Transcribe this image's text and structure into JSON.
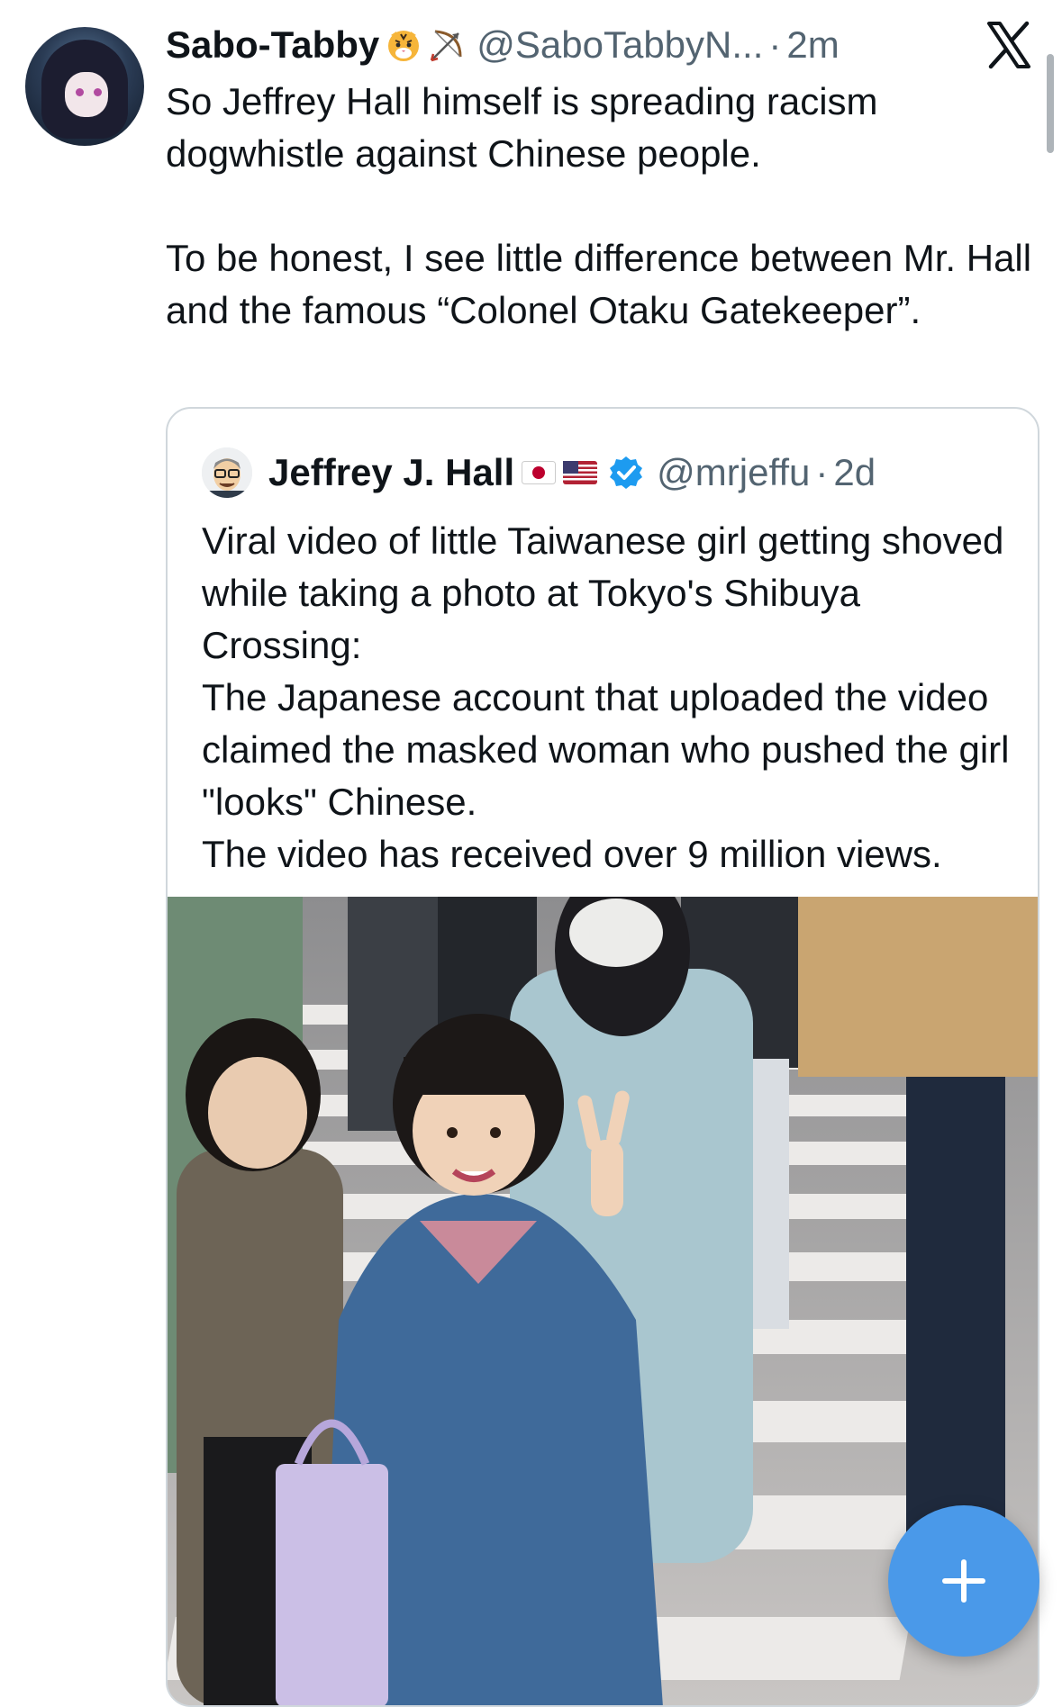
{
  "tweet": {
    "display_name": "Sabo-Tabby",
    "name_emojis": [
      "tiger-face-emoji",
      "bow-and-arrow-emoji"
    ],
    "handle": "@SaboTabbyN...",
    "separator": "·",
    "time": "2m",
    "paragraphs": [
      "So Jeffrey Hall himself is spreading racism dogwhistle against Chinese people.",
      "To be honest, I see little difference between Mr. Hall and the famous “Colonel Otaku Gatekeeper”."
    ]
  },
  "quoted_tweet": {
    "display_name": "Jeffrey J. Hall",
    "flags": [
      "japan-flag",
      "usa-flag"
    ],
    "verified": true,
    "handle": "@mrjeffu",
    "separator": "·",
    "time": "2d",
    "lines": [
      "Viral video of little Taiwanese girl getting shoved while taking a photo at Tokyo's Shibuya Crossing:",
      "The Japanese account that uploaded the video claimed the masked woman who pushed the girl \"looks\" Chinese.",
      "The video has received over 9 million views."
    ],
    "media": {
      "type": "video-still",
      "subject": "girls-posing-at-shibuya-crossing"
    }
  },
  "header": {
    "logo_icon": "x-logo-icon"
  },
  "compose_button": {
    "icon": "plus-icon",
    "color": "#4a99e9"
  },
  "colors": {
    "text": "#0f1419",
    "muted": "#536471",
    "accent": "#1d9bf0",
    "border": "#d0d7dc"
  }
}
